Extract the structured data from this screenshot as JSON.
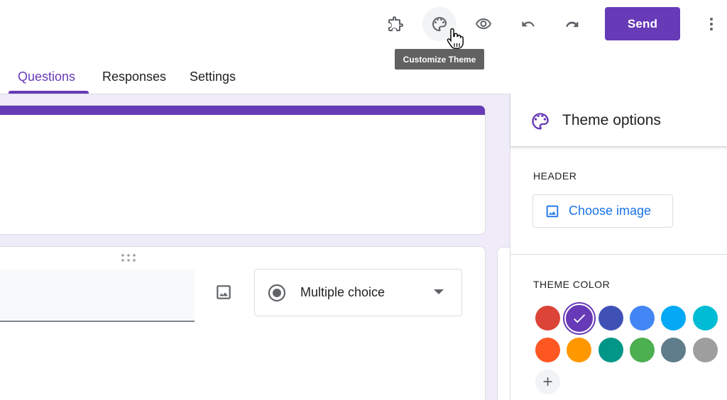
{
  "toolbar": {
    "addons_icon": "puzzle-icon",
    "theme_icon": "palette-icon",
    "preview_icon": "eye-icon",
    "undo_icon": "undo-icon",
    "redo_icon": "redo-icon",
    "send_label": "Send",
    "more_icon": "more-vert-icon",
    "tooltip": "Customize Theme"
  },
  "tabs": [
    {
      "label": "Questions",
      "active": true
    },
    {
      "label": "Responses",
      "active": false
    },
    {
      "label": "Settings",
      "active": false
    }
  ],
  "question": {
    "type_label": "Multiple choice",
    "add_image_icon": "image-icon"
  },
  "theme_panel": {
    "title": "Theme options",
    "header_label": "HEADER",
    "choose_image_label": "Choose image",
    "theme_color_label": "THEME COLOR",
    "colors": [
      "#db4437",
      "#673ab7",
      "#3f51b5",
      "#4285f4",
      "#03a9f4",
      "#00bcd4",
      "#ff5722",
      "#ff9800",
      "#009688",
      "#4caf50",
      "#607d8b",
      "#9e9e9e"
    ],
    "selected_color": "#673ab7",
    "add_color_symbol": "+"
  },
  "accent_color": "#673ab7"
}
